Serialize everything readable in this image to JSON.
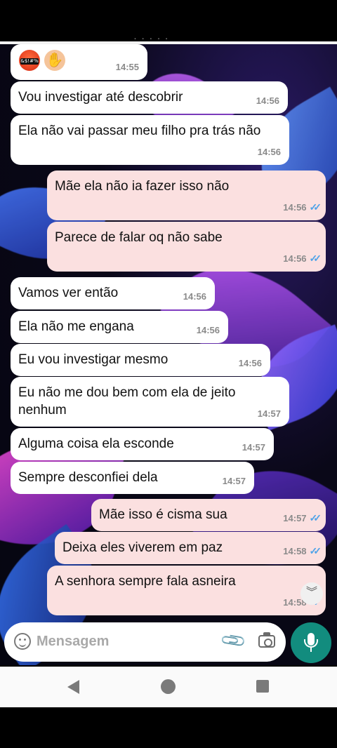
{
  "header": {
    "partial_title": "· · · · ·"
  },
  "messages": [
    {
      "dir": "in",
      "text": "",
      "time": "14:55",
      "emojis": [
        "angry-face-with-symbols",
        "ok-hand"
      ]
    },
    {
      "dir": "in",
      "text": "Vou investigar até descobrir",
      "time": "14:56"
    },
    {
      "dir": "in",
      "text": "Ela não vai passar meu filho pra trás não",
      "time": "14:56"
    },
    {
      "dir": "out",
      "text": "Mãe ela não ia fazer isso não",
      "time": "14:56"
    },
    {
      "dir": "out",
      "text": "Parece de falar oq não sabe",
      "time": "14:56"
    },
    {
      "dir": "in",
      "text": "Vamos ver então",
      "time": "14:56"
    },
    {
      "dir": "in",
      "text": "Ela não me engana",
      "time": "14:56"
    },
    {
      "dir": "in",
      "text": "Eu vou investigar mesmo",
      "time": "14:56"
    },
    {
      "dir": "in",
      "text": "Eu não me dou bem com ela de jeito nenhum",
      "time": "14:57"
    },
    {
      "dir": "in",
      "text": "Alguma coisa ela esconde",
      "time": "14:57"
    },
    {
      "dir": "in",
      "text": "Sempre desconfiei dela",
      "time": "14:57"
    },
    {
      "dir": "out",
      "text": "Mãe isso é cisma sua",
      "time": "14:57"
    },
    {
      "dir": "out",
      "text": "Deixa eles viverem em paz",
      "time": "14:58"
    },
    {
      "dir": "out",
      "text": "A senhora sempre fala asneira",
      "time": "14:58"
    }
  ],
  "emoji_labels": {
    "angry_symbols": "&$!#%"
  },
  "composer": {
    "placeholder": "Mensagem"
  },
  "icons": {
    "emoji": "smiley-icon",
    "attach": "paperclip-icon",
    "camera": "camera-icon",
    "mic": "microphone-icon",
    "scroll": "chevron-double-down-icon",
    "back": "nav-back-icon",
    "home": "nav-home-icon",
    "recent": "nav-recents-icon"
  },
  "colors": {
    "incoming": "#ffffff",
    "outgoing": "#fbe0e0",
    "ticks": "#4fa3e8",
    "mic": "#128c7e"
  }
}
